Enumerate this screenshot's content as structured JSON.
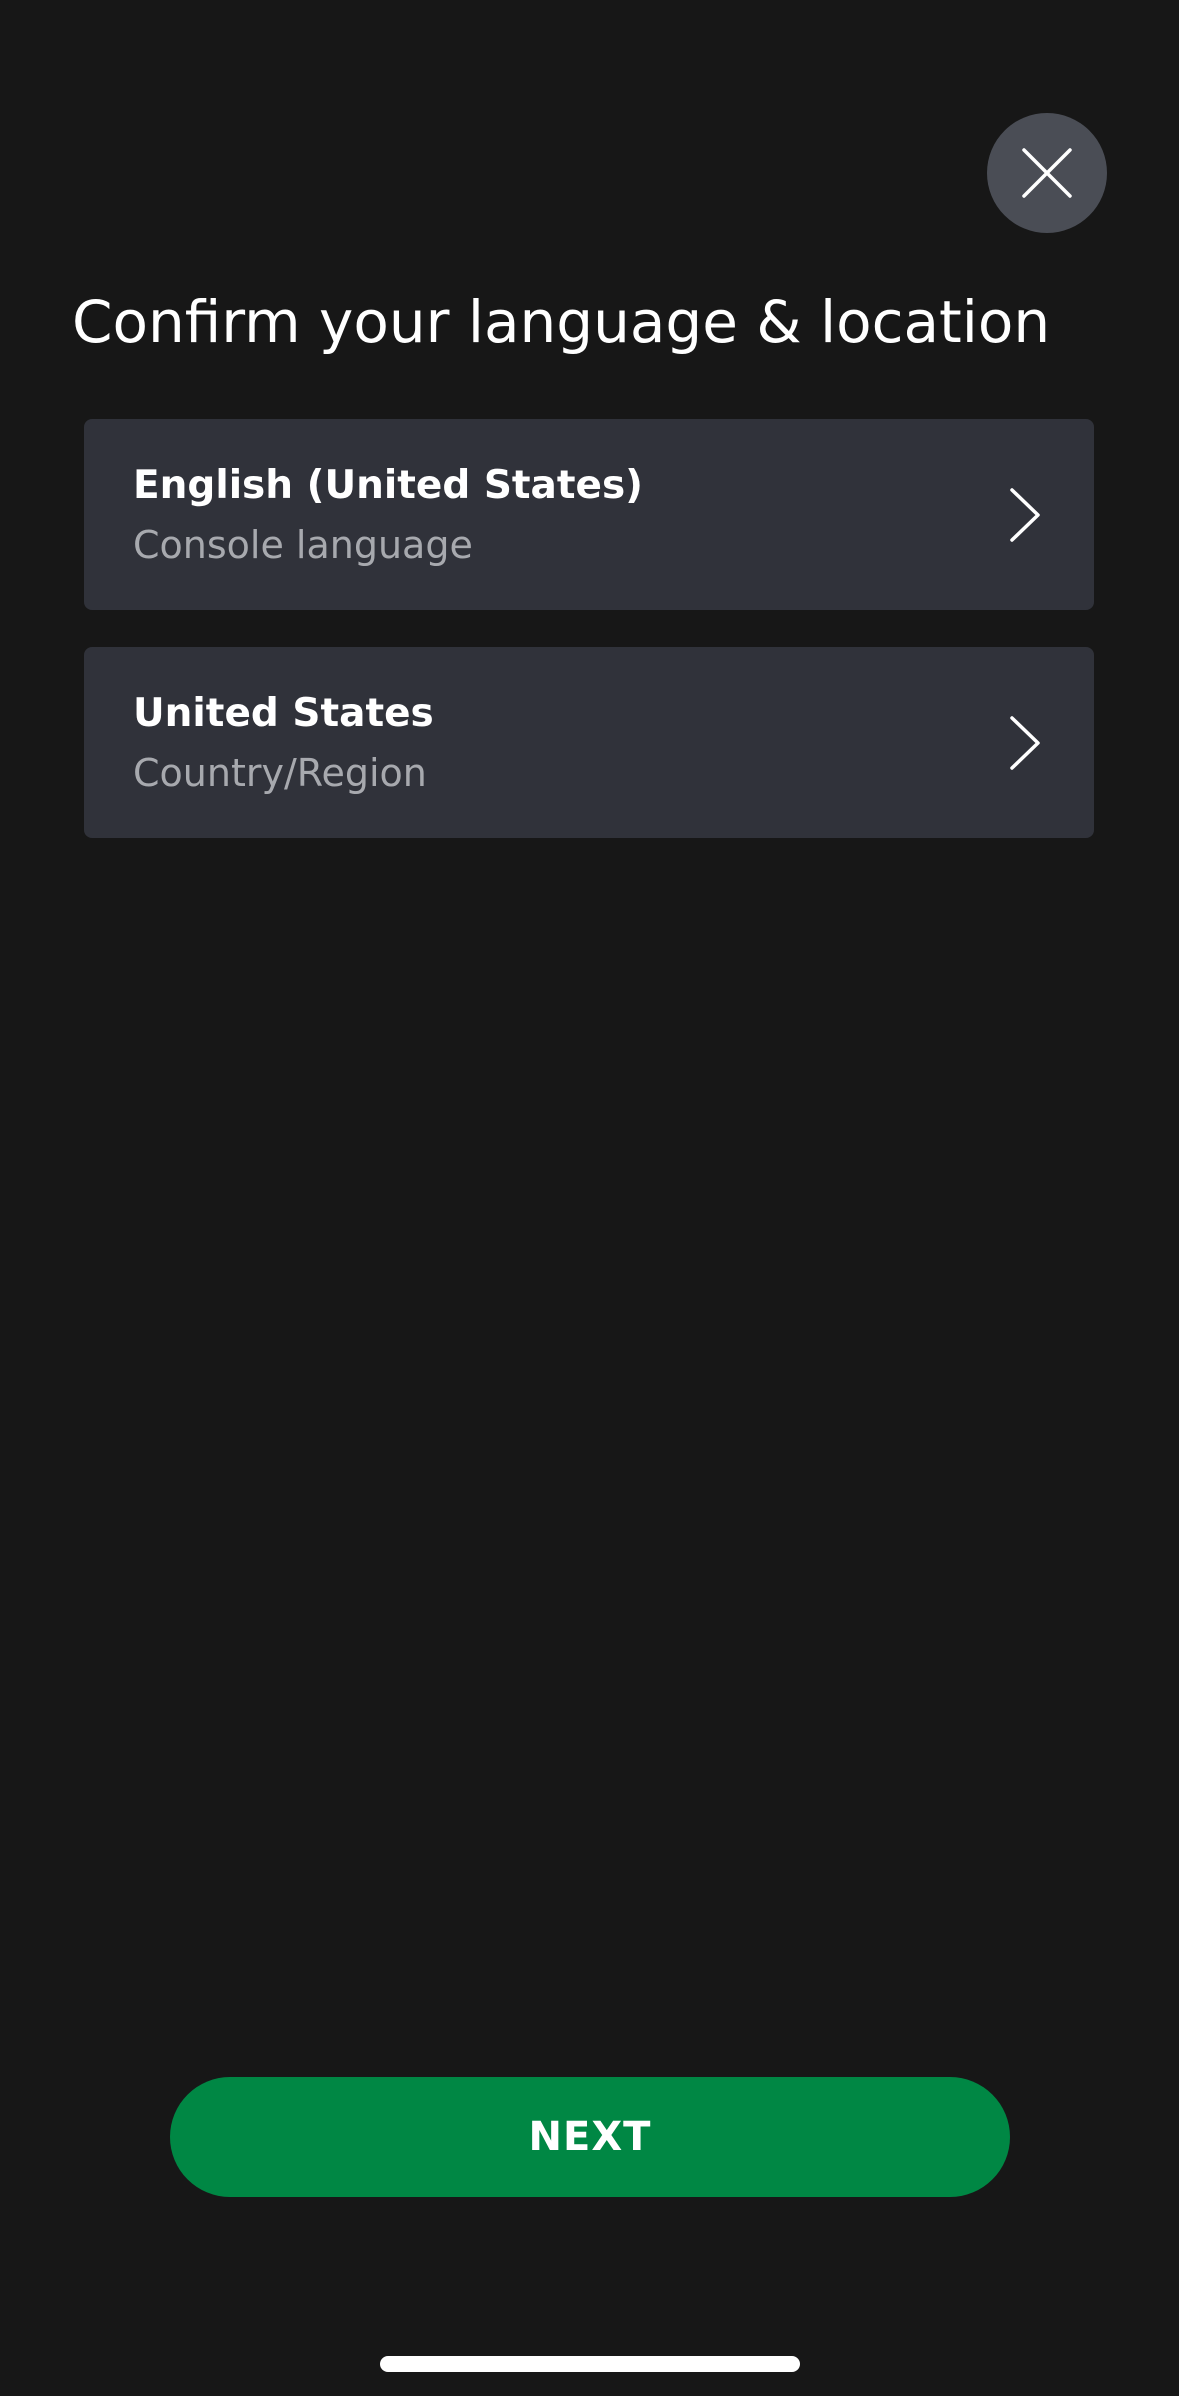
{
  "header": {
    "title": "Confirm your language & location",
    "close_icon": "close-icon"
  },
  "options": [
    {
      "primary": "English (United States)",
      "secondary": "Console language",
      "icon": "chevron-right-icon"
    },
    {
      "primary": "United States",
      "secondary": "Country/Region",
      "icon": "chevron-right-icon"
    }
  ],
  "footer": {
    "next_label": "NEXT"
  },
  "colors": {
    "background": "#171717",
    "card": "#30323a",
    "close_button": "#4a4d55",
    "accent_green": "#008744",
    "secondary_text": "#a7a9ae"
  }
}
